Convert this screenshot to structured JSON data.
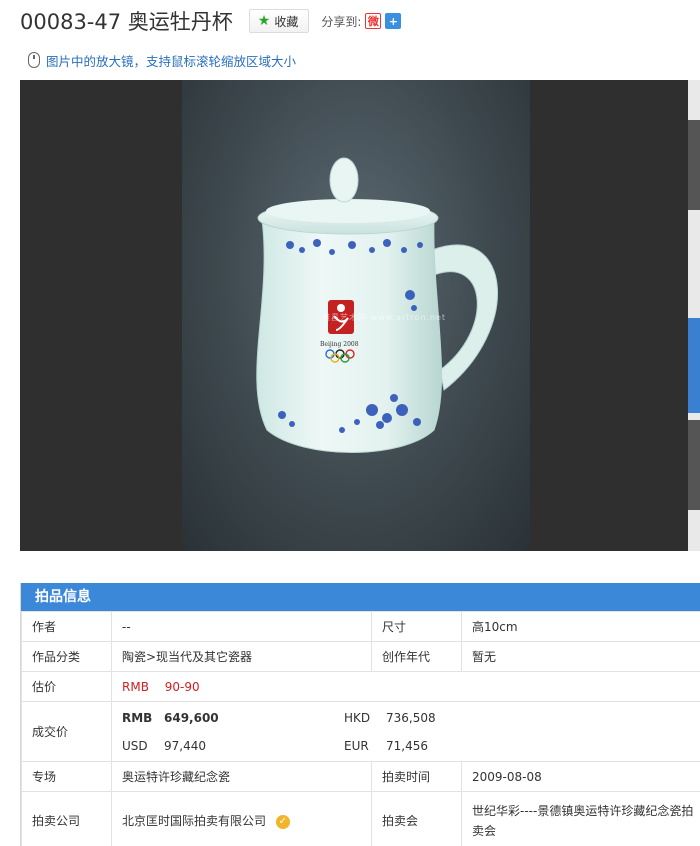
{
  "header": {
    "title": "00083-47 奥运牡丹杯",
    "fav_label": "收藏",
    "share_label": "分享到:",
    "share_icons": [
      "weibo-icon",
      "plus-share-icon"
    ]
  },
  "hint": "图片中的放大镜，支持鼠标滚轮缩放区域大小",
  "image": {
    "watermark": "雅昌艺术网 www.artron.net",
    "logo_caption": "Beijing 2008"
  },
  "info": {
    "heading": "拍品信息",
    "rows": {
      "author_label": "作者",
      "author_value": "--",
      "size_label": "尺寸",
      "size_value": "高10cm",
      "category_label": "作品分类",
      "category_value": "陶瓷>现当代及其它瓷器",
      "year_label": "创作年代",
      "year_value": "暂无",
      "estimate_label": "估价",
      "estimate_currency": "RMB",
      "estimate_value": "90-90",
      "deal_label": "成交价",
      "deal_rmb_cur": "RMB",
      "deal_rmb": "649,600",
      "deal_hkd_cur": "HKD",
      "deal_hkd": "736,508",
      "deal_usd_cur": "USD",
      "deal_usd": "97,440",
      "deal_eur_cur": "EUR",
      "deal_eur": "71,456",
      "session_label": "专场",
      "session_value": "奥运特许珍藏纪念瓷",
      "time_label": "拍卖时间",
      "time_value": "2009-08-08",
      "company_label": "拍卖公司",
      "company_value": "北京匡时国际拍卖有限公司",
      "auction_label": "拍卖会",
      "auction_value": "世纪华彩----景德镇奥运特许珍藏纪念瓷拍卖会"
    }
  }
}
